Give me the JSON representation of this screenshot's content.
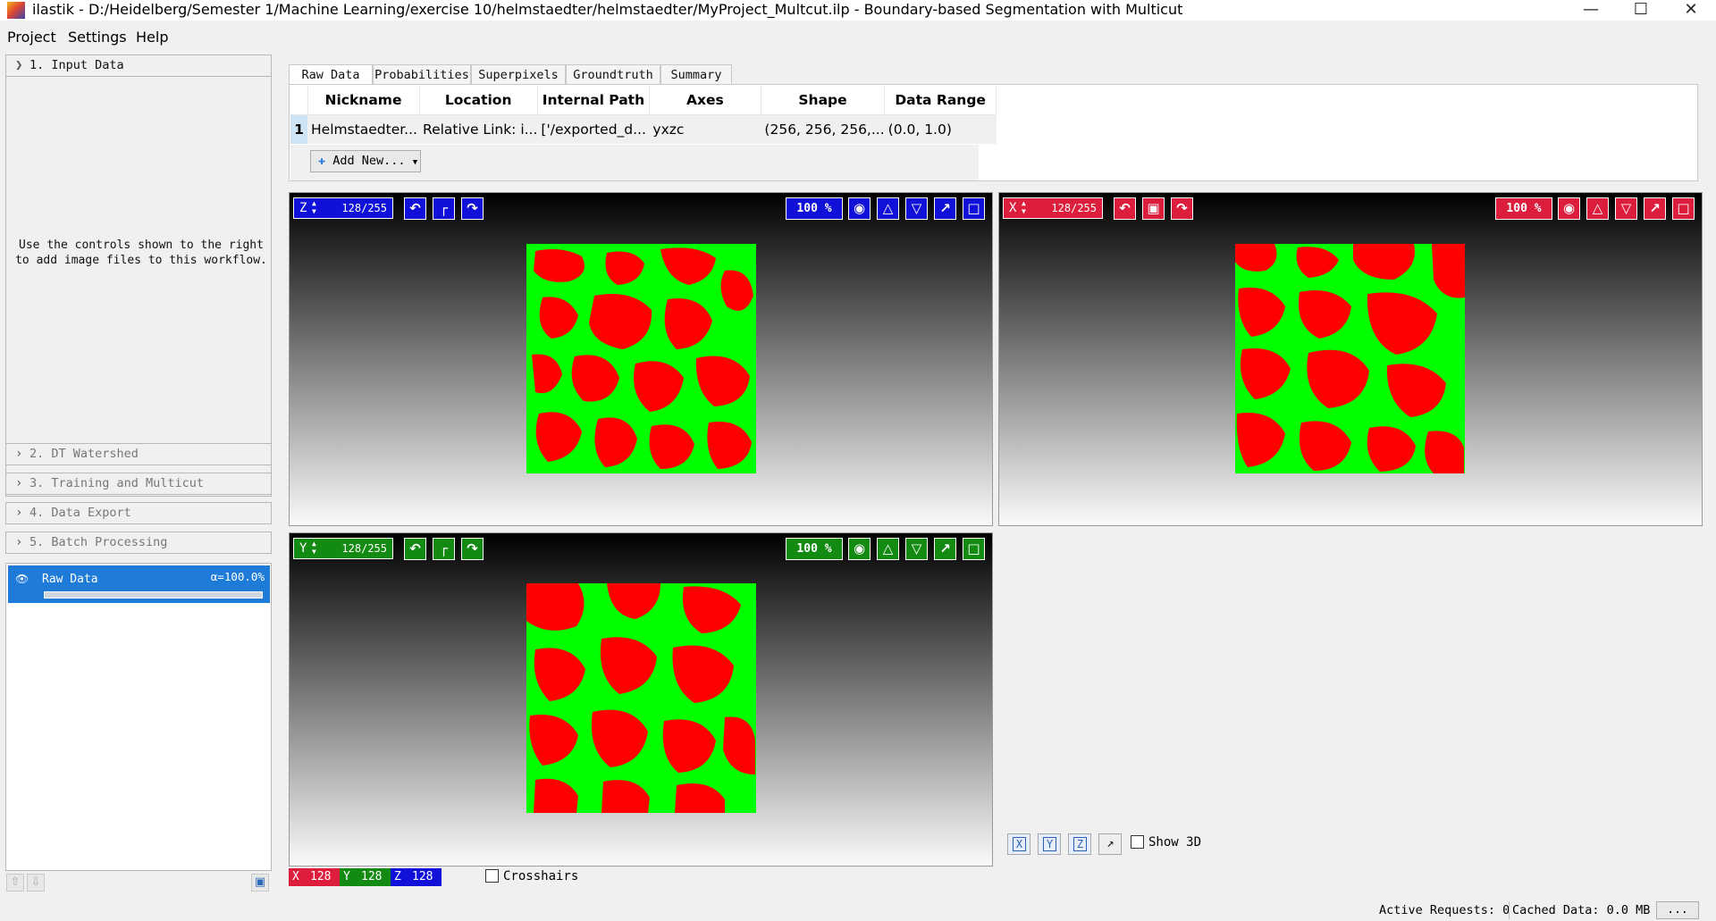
{
  "window": {
    "title": "ilastik - D:/Heidelberg/Semester 1/Machine Learning/exercise 10/helmstaedter/helmstaedter/MyProject_Multcut.ilp - Boundary-based Segmentation with Multicut",
    "minimize": "—",
    "maximize": "☐",
    "close": "✕"
  },
  "menu": [
    "Project",
    "Settings",
    "Help"
  ],
  "applets": [
    {
      "label": "1.  Input Data",
      "expanded": true
    },
    {
      "label": "2.  DT Watershed",
      "expanded": false
    },
    {
      "label": "3.  Training and Multicut",
      "expanded": false
    },
    {
      "label": "4.  Data Export",
      "expanded": false
    },
    {
      "label": "5.  Batch Processing",
      "expanded": false
    }
  ],
  "applet_instructions": "Use the controls shown to the right to add image files to this workflow.",
  "layers": [
    {
      "name": "Raw Data",
      "opacity": "α=100.0%",
      "opacity_fraction": 1.0,
      "visible": true
    }
  ],
  "tabs": [
    "Raw Data",
    "Probabilities",
    "Superpixels",
    "Groundtruth",
    "Summary"
  ],
  "active_tab": "Raw Data",
  "table": {
    "columns": [
      "Nickname",
      "Location",
      "Internal Path",
      "Axes",
      "Shape",
      "Data Range"
    ],
    "rows": [
      {
        "index": "1",
        "cells": [
          "Helmstaedter...",
          "Relative Link: i...",
          "['/exported_d...",
          "yxzc",
          "(256, 256, 256,...",
          "(0.0, 1.0)"
        ]
      }
    ]
  },
  "add_new_label": "Add New...",
  "add_new_icon": "plus-icon",
  "viewers": {
    "z": {
      "axis": "Z",
      "slice": "128/255",
      "zoom": "100 %",
      "color": "#1010d8"
    },
    "x": {
      "axis": "X",
      "slice": "128/255",
      "zoom": "100 %",
      "color": "#dc1d3c"
    },
    "y": {
      "axis": "Y",
      "slice": "128/255",
      "zoom": "100 %",
      "color": "#138b13"
    }
  },
  "colors": {
    "segmentation_a": "#ff0000",
    "segmentation_b": "#00ff00",
    "selection": "#1e7bd8"
  },
  "coords": {
    "x_label": "X",
    "x_value": "128",
    "y_label": "Y",
    "y_value": "128",
    "z_label": "Z",
    "z_value": "128"
  },
  "crosshairs_label": "Crosshairs",
  "axis_buttons": [
    "X",
    "Y",
    "Z"
  ],
  "show3d_label": "Show 3D",
  "status": {
    "active_requests": "Active Requests: 0",
    "cached_data": "Cached Data: 0.0 MB",
    "more": "..."
  }
}
